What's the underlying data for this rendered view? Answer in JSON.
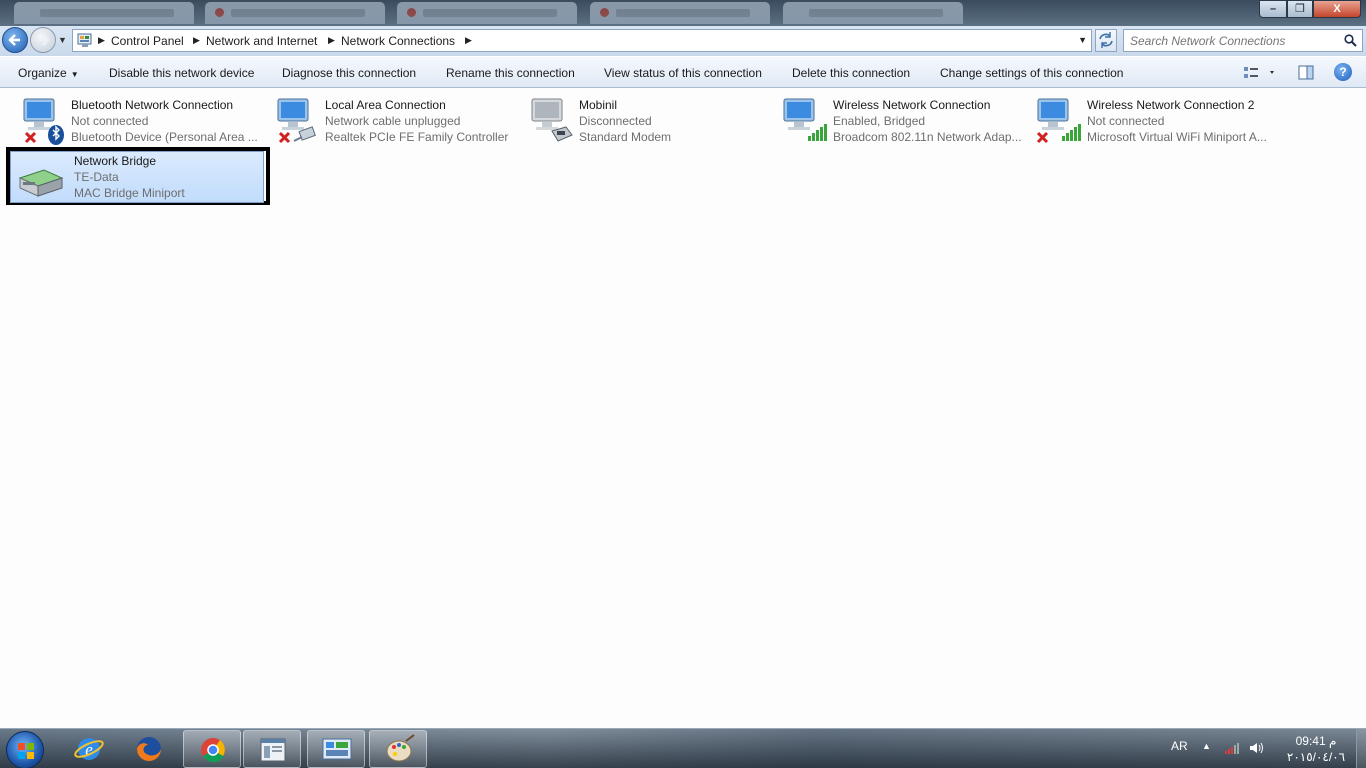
{
  "window": {
    "min_label": "–",
    "max_label": "❐",
    "close_label": "X"
  },
  "address": {
    "crumbs": [
      "Control Panel",
      "Network and Internet",
      "Network Connections"
    ]
  },
  "search": {
    "placeholder": "Search Network Connections"
  },
  "toolbar": {
    "organize": "Organize",
    "disable": "Disable this network device",
    "diagnose": "Diagnose this connection",
    "rename": "Rename this connection",
    "view_status": "View status of this connection",
    "delete": "Delete this connection",
    "change_settings": "Change settings of this connection",
    "help": "?"
  },
  "connections": [
    {
      "name": "Bluetooth Network Connection",
      "status": "Not connected",
      "device": "Bluetooth Device (Personal Area ...",
      "icon": "bluetooth-network-icon"
    },
    {
      "name": "Local Area Connection",
      "status": "Network cable unplugged",
      "device": "Realtek PCIe FE Family Controller",
      "icon": "ethernet-network-icon"
    },
    {
      "name": "Mobinil",
      "status": "Disconnected",
      "device": "Standard Modem",
      "icon": "modem-network-icon"
    },
    {
      "name": "Wireless Network Connection",
      "status": "Enabled, Bridged",
      "device": "Broadcom 802.11n Network Adap...",
      "icon": "wireless-network-icon"
    },
    {
      "name": "Wireless Network Connection 2",
      "status": "Not connected",
      "device": "Microsoft Virtual WiFi Miniport A...",
      "icon": "wireless-network-icon"
    },
    {
      "name": "Network Bridge",
      "status": "TE-Data",
      "device": "MAC Bridge Miniport",
      "icon": "network-bridge-icon"
    }
  ],
  "taskbar": {
    "language": "AR",
    "time": "09:41 م",
    "date": "٢٠١٥/٠٤/٠٦"
  }
}
